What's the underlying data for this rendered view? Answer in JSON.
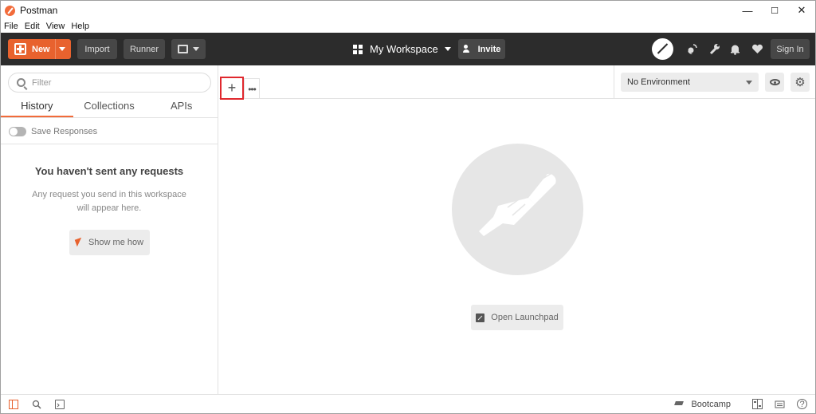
{
  "window": {
    "title": "Postman",
    "minimize": "—",
    "maximize": "☐",
    "close": "✕"
  },
  "menu": [
    "File",
    "Edit",
    "View",
    "Help"
  ],
  "header": {
    "new_label": "New",
    "import_label": "Import",
    "runner_label": "Runner",
    "workspace_label": "My Workspace",
    "invite_label": "Invite",
    "signin_label": "Sign In"
  },
  "sidebar": {
    "filter_placeholder": "Filter",
    "tabs": [
      "History",
      "Collections",
      "APIs"
    ],
    "active_tab": "History",
    "save_responses": "Save Responses",
    "empty_title": "You haven't sent any requests",
    "empty_desc": "Any request you send in this workspace will appear here.",
    "show_me": "Show me how"
  },
  "main": {
    "add_tab": "+",
    "more_tabs": "•••",
    "environment": "No Environment",
    "launchpad": "Open Launchpad"
  },
  "statusbar": {
    "bootcamp": "Bootcamp",
    "help": "?"
  },
  "colors": {
    "accent": "#e8622e",
    "header_bg": "#2c2c2c",
    "highlight_box": "#e0282e"
  }
}
